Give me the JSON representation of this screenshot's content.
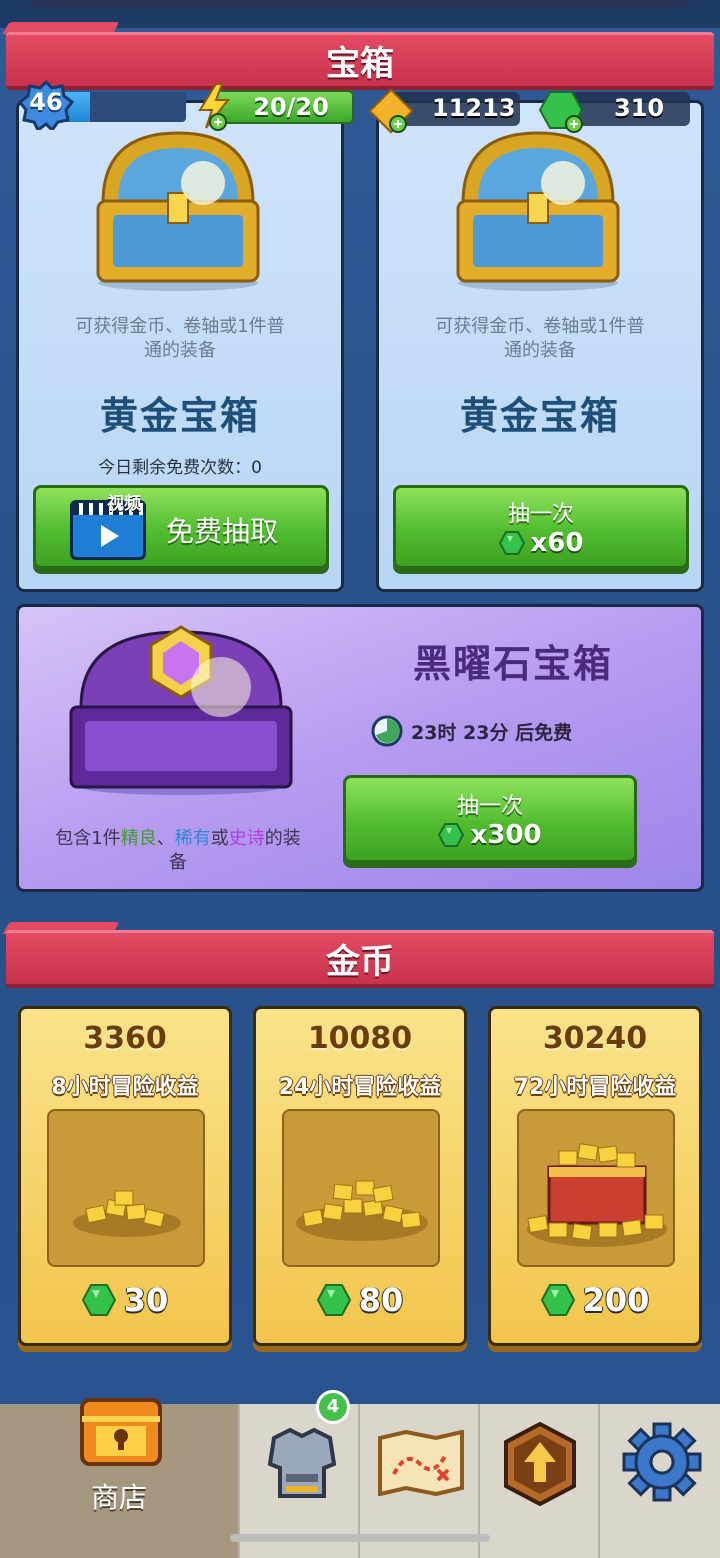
{
  "sections": {
    "chests_title": "宝箱",
    "gold_title": "金币"
  },
  "resources": {
    "level": "46",
    "xp_progress": 0.24,
    "energy": "20/20",
    "scrolls": "11213",
    "gems": "310"
  },
  "chests": [
    {
      "desc_line1": "可获得金币、卷轴或1件普",
      "desc_line2": "通的装备",
      "name": "黄金宝箱",
      "note": "今日剩余免费次数：0",
      "button_badge": "视频",
      "button_label": "免费抽取"
    },
    {
      "desc_line1": "可获得金币、卷轴或1件普",
      "desc_line2": "通的装备",
      "name": "黄金宝箱",
      "button_label": "抽一次",
      "button_price": "x60"
    }
  ],
  "obsidian": {
    "name": "黑曜石宝箱",
    "timer": "23时 23分 后免费",
    "desc_line1_a": "包含1件",
    "desc_rare1": "精良",
    "desc_sep": "、",
    "desc_rare2": "稀有",
    "desc_or": "或",
    "desc_rare3": "史诗",
    "desc_tail": "的装",
    "desc_line2": "备",
    "button_label": "抽一次",
    "button_price": "x300"
  },
  "gold_offers": [
    {
      "amount": "3360",
      "label": "8小时冒险收益",
      "price": "30"
    },
    {
      "amount": "10080",
      "label": "24小时冒险收益",
      "price": "80"
    },
    {
      "amount": "30240",
      "label": "72小时冒险收益",
      "price": "200"
    }
  ],
  "nav": {
    "shop_label": "商店",
    "equipment_badge": "4"
  },
  "colors": {
    "banner_red": "#d63a55",
    "button_green": "#51bc30",
    "gem_green": "#35c24a",
    "rare_green": "#3f9a2f",
    "rare_blue": "#2f86d6",
    "rare_purple": "#b23ae0"
  }
}
